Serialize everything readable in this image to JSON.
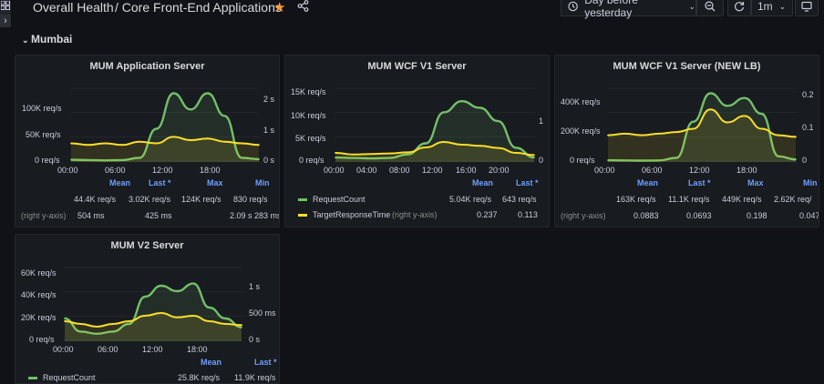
{
  "breadcrumb": {
    "folder": "Overall Health",
    "dashboard": "/ Core Front-End Applications"
  },
  "toolbar": {
    "time_range": "Day before yesterday",
    "refresh_interval": "1m"
  },
  "row": {
    "title": "Mumbai"
  },
  "colors": {
    "green": "#73bf69",
    "yellow": "#fade2a",
    "blue_header": "#6e9fff",
    "background": "#111217",
    "panel": "#181b1f"
  },
  "icons": [
    "sidebar-toggle-icon",
    "star-icon",
    "share-icon",
    "clock-icon",
    "chevron-down-icon",
    "zoom-out-icon",
    "refresh-icon",
    "tv-icon"
  ],
  "legend_headers": {
    "mean": "Mean",
    "last": "Last *",
    "max": "Max",
    "min": "Min"
  },
  "panels": [
    {
      "title": "MUM Application Server",
      "left_ticks": [
        "100K req/s",
        "50K req/s",
        "0 req/s"
      ],
      "right_ticks": [
        "2 s",
        "1 s",
        "0 s"
      ],
      "x_ticks": [
        "00:00",
        "06:00",
        "12:00",
        "18:00"
      ],
      "rows": [
        {
          "label": "",
          "mean": "44.4K req/s",
          "last": "3.02K req/s",
          "max": "124K req/s",
          "min": "830 req/s"
        },
        {
          "label": "(right y-axis)",
          "mean": "504 ms",
          "last": "425 ms",
          "max": "2.09 s",
          "min": "283 ms"
        }
      ]
    },
    {
      "title": "MUM WCF V1 Server",
      "left_ticks": [
        "15K req/s",
        "10K req/s",
        "5K req/s",
        "0 req/s"
      ],
      "right_ticks": [
        "1",
        "0"
      ],
      "x_ticks": [
        "00:00",
        "04:00",
        "08:00",
        "12:00",
        "16:00",
        "20:00"
      ],
      "rows": [
        {
          "label": "RequestCount",
          "mean": "5.04K req/s",
          "last": "643 req/s"
        },
        {
          "label": "TargetResponseTime",
          "axis_note": "(right y-axis)",
          "mean": "0.237",
          "last": "0.113"
        }
      ]
    },
    {
      "title": "MUM WCF V1 Server (NEW LB)",
      "left_ticks": [
        "400K req/s",
        "200K req/s",
        "0 req/s"
      ],
      "right_ticks": [
        "0.2",
        "0.1",
        "0"
      ],
      "x_ticks": [
        "00:00",
        "06:00",
        "12:00",
        "18:00"
      ],
      "rows": [
        {
          "label": "",
          "mean": "163K req/s",
          "last": "11.1K req/s",
          "max": "449K req/s",
          "min": "2.62K req/"
        },
        {
          "label": "(right y-axis)",
          "mean": "0.0883",
          "last": "0.0693",
          "max": "0.198",
          "min": "0.047"
        }
      ]
    },
    {
      "title": "MUM V2 Server",
      "left_ticks": [
        "60K req/s",
        "40K req/s",
        "20K req/s",
        "0 req/s"
      ],
      "right_ticks": [
        "1 s",
        "500 ms",
        "0 s"
      ],
      "x_ticks": [
        "00:00",
        "06:00",
        "12:00",
        "18:00"
      ],
      "rows": [
        {
          "label": "RequestCount",
          "mean": "25.8K req/s",
          "last": "11.9K req/s"
        }
      ]
    }
  ],
  "chart_data": [
    {
      "type": "line",
      "title": "MUM Application Server",
      "x": [
        "00:00",
        "02:00",
        "04:00",
        "06:00",
        "08:00",
        "10:00",
        "12:00",
        "14:00",
        "16:00",
        "18:00",
        "20:00",
        "22:00"
      ],
      "ylim": [
        0,
        110000
      ],
      "y2lim": [
        0,
        2.2
      ],
      "series": [
        {
          "axis": "left",
          "values": [
            2000,
            1500,
            1000,
            1500,
            5000,
            50000,
            105000,
            80000,
            105000,
            70000,
            5000,
            3000
          ]
        },
        {
          "axis": "right",
          "values": [
            0.55,
            0.5,
            0.55,
            0.5,
            0.6,
            0.55,
            0.75,
            0.65,
            0.7,
            0.6,
            0.55,
            0.5
          ]
        }
      ]
    },
    {
      "type": "line",
      "title": "MUM WCF V1 Server",
      "x": [
        "00:00",
        "02:00",
        "04:00",
        "06:00",
        "08:00",
        "10:00",
        "12:00",
        "14:00",
        "16:00",
        "18:00",
        "20:00",
        "22:00"
      ],
      "ylim": [
        0,
        16000
      ],
      "y2lim": [
        0,
        1.3
      ],
      "series": [
        {
          "name": "RequestCount",
          "axis": "left",
          "values": [
            800,
            700,
            600,
            700,
            1500,
            4000,
            11000,
            13500,
            12000,
            9000,
            3000,
            800
          ]
        },
        {
          "name": "TargetResponseTime",
          "axis": "right",
          "values": [
            0.15,
            0.12,
            0.13,
            0.14,
            0.16,
            0.25,
            0.35,
            0.3,
            0.28,
            0.24,
            0.15,
            0.11
          ]
        }
      ]
    },
    {
      "type": "line",
      "title": "MUM WCF V1 Server (NEW LB)",
      "x": [
        "00:00",
        "02:00",
        "04:00",
        "06:00",
        "08:00",
        "10:00",
        "12:00",
        "14:00",
        "16:00",
        "18:00",
        "20:00",
        "22:00"
      ],
      "ylim": [
        0,
        450000
      ],
      "y2lim": [
        0,
        0.22
      ],
      "series": [
        {
          "axis": "left",
          "values": [
            5000,
            4000,
            3000,
            4000,
            20000,
            250000,
            430000,
            350000,
            400000,
            300000,
            30000,
            10000
          ]
        },
        {
          "axis": "right",
          "values": [
            0.08,
            0.085,
            0.08,
            0.085,
            0.09,
            0.1,
            0.16,
            0.12,
            0.14,
            0.1,
            0.08,
            0.075
          ]
        }
      ]
    },
    {
      "type": "line",
      "title": "MUM V2 Server",
      "x": [
        "00:00",
        "02:00",
        "04:00",
        "06:00",
        "08:00",
        "10:00",
        "12:00",
        "14:00",
        "16:00",
        "18:00",
        "20:00",
        "22:00"
      ],
      "ylim": [
        0,
        65000
      ],
      "y2lim": [
        0,
        1.3
      ],
      "series": [
        {
          "name": "RequestCount",
          "axis": "left",
          "values": [
            20000,
            8000,
            6000,
            8000,
            15000,
            40000,
            50000,
            45000,
            52000,
            30000,
            20000,
            12000
          ]
        },
        {
          "axis": "right",
          "values": [
            0.35,
            0.3,
            0.25,
            0.3,
            0.35,
            0.45,
            0.5,
            0.42,
            0.45,
            0.35,
            0.3,
            0.28
          ]
        }
      ]
    }
  ]
}
